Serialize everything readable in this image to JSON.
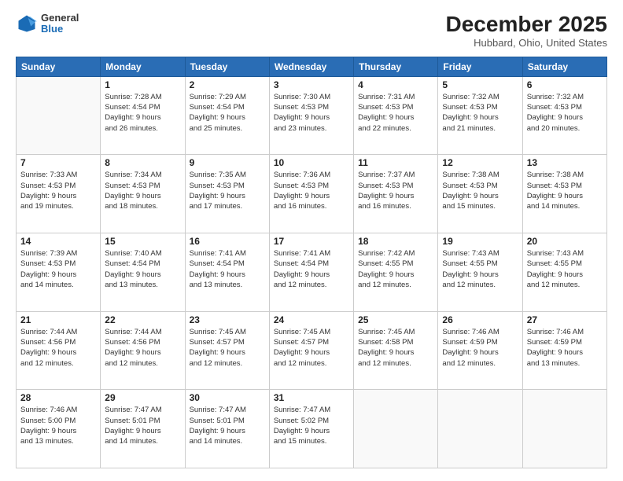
{
  "logo": {
    "general": "General",
    "blue": "Blue"
  },
  "header": {
    "month": "December 2025",
    "location": "Hubbard, Ohio, United States"
  },
  "weekdays": [
    "Sunday",
    "Monday",
    "Tuesday",
    "Wednesday",
    "Thursday",
    "Friday",
    "Saturday"
  ],
  "weeks": [
    [
      {
        "day": "",
        "info": ""
      },
      {
        "day": "1",
        "info": "Sunrise: 7:28 AM\nSunset: 4:54 PM\nDaylight: 9 hours\nand 26 minutes."
      },
      {
        "day": "2",
        "info": "Sunrise: 7:29 AM\nSunset: 4:54 PM\nDaylight: 9 hours\nand 25 minutes."
      },
      {
        "day": "3",
        "info": "Sunrise: 7:30 AM\nSunset: 4:53 PM\nDaylight: 9 hours\nand 23 minutes."
      },
      {
        "day": "4",
        "info": "Sunrise: 7:31 AM\nSunset: 4:53 PM\nDaylight: 9 hours\nand 22 minutes."
      },
      {
        "day": "5",
        "info": "Sunrise: 7:32 AM\nSunset: 4:53 PM\nDaylight: 9 hours\nand 21 minutes."
      },
      {
        "day": "6",
        "info": "Sunrise: 7:32 AM\nSunset: 4:53 PM\nDaylight: 9 hours\nand 20 minutes."
      }
    ],
    [
      {
        "day": "7",
        "info": "Sunrise: 7:33 AM\nSunset: 4:53 PM\nDaylight: 9 hours\nand 19 minutes."
      },
      {
        "day": "8",
        "info": "Sunrise: 7:34 AM\nSunset: 4:53 PM\nDaylight: 9 hours\nand 18 minutes."
      },
      {
        "day": "9",
        "info": "Sunrise: 7:35 AM\nSunset: 4:53 PM\nDaylight: 9 hours\nand 17 minutes."
      },
      {
        "day": "10",
        "info": "Sunrise: 7:36 AM\nSunset: 4:53 PM\nDaylight: 9 hours\nand 16 minutes."
      },
      {
        "day": "11",
        "info": "Sunrise: 7:37 AM\nSunset: 4:53 PM\nDaylight: 9 hours\nand 16 minutes."
      },
      {
        "day": "12",
        "info": "Sunrise: 7:38 AM\nSunset: 4:53 PM\nDaylight: 9 hours\nand 15 minutes."
      },
      {
        "day": "13",
        "info": "Sunrise: 7:38 AM\nSunset: 4:53 PM\nDaylight: 9 hours\nand 14 minutes."
      }
    ],
    [
      {
        "day": "14",
        "info": "Sunrise: 7:39 AM\nSunset: 4:53 PM\nDaylight: 9 hours\nand 14 minutes."
      },
      {
        "day": "15",
        "info": "Sunrise: 7:40 AM\nSunset: 4:54 PM\nDaylight: 9 hours\nand 13 minutes."
      },
      {
        "day": "16",
        "info": "Sunrise: 7:41 AM\nSunset: 4:54 PM\nDaylight: 9 hours\nand 13 minutes."
      },
      {
        "day": "17",
        "info": "Sunrise: 7:41 AM\nSunset: 4:54 PM\nDaylight: 9 hours\nand 12 minutes."
      },
      {
        "day": "18",
        "info": "Sunrise: 7:42 AM\nSunset: 4:55 PM\nDaylight: 9 hours\nand 12 minutes."
      },
      {
        "day": "19",
        "info": "Sunrise: 7:43 AM\nSunset: 4:55 PM\nDaylight: 9 hours\nand 12 minutes."
      },
      {
        "day": "20",
        "info": "Sunrise: 7:43 AM\nSunset: 4:55 PM\nDaylight: 9 hours\nand 12 minutes."
      }
    ],
    [
      {
        "day": "21",
        "info": "Sunrise: 7:44 AM\nSunset: 4:56 PM\nDaylight: 9 hours\nand 12 minutes."
      },
      {
        "day": "22",
        "info": "Sunrise: 7:44 AM\nSunset: 4:56 PM\nDaylight: 9 hours\nand 12 minutes."
      },
      {
        "day": "23",
        "info": "Sunrise: 7:45 AM\nSunset: 4:57 PM\nDaylight: 9 hours\nand 12 minutes."
      },
      {
        "day": "24",
        "info": "Sunrise: 7:45 AM\nSunset: 4:57 PM\nDaylight: 9 hours\nand 12 minutes."
      },
      {
        "day": "25",
        "info": "Sunrise: 7:45 AM\nSunset: 4:58 PM\nDaylight: 9 hours\nand 12 minutes."
      },
      {
        "day": "26",
        "info": "Sunrise: 7:46 AM\nSunset: 4:59 PM\nDaylight: 9 hours\nand 12 minutes."
      },
      {
        "day": "27",
        "info": "Sunrise: 7:46 AM\nSunset: 4:59 PM\nDaylight: 9 hours\nand 13 minutes."
      }
    ],
    [
      {
        "day": "28",
        "info": "Sunrise: 7:46 AM\nSunset: 5:00 PM\nDaylight: 9 hours\nand 13 minutes."
      },
      {
        "day": "29",
        "info": "Sunrise: 7:47 AM\nSunset: 5:01 PM\nDaylight: 9 hours\nand 14 minutes."
      },
      {
        "day": "30",
        "info": "Sunrise: 7:47 AM\nSunset: 5:01 PM\nDaylight: 9 hours\nand 14 minutes."
      },
      {
        "day": "31",
        "info": "Sunrise: 7:47 AM\nSunset: 5:02 PM\nDaylight: 9 hours\nand 15 minutes."
      },
      {
        "day": "",
        "info": ""
      },
      {
        "day": "",
        "info": ""
      },
      {
        "day": "",
        "info": ""
      }
    ]
  ]
}
